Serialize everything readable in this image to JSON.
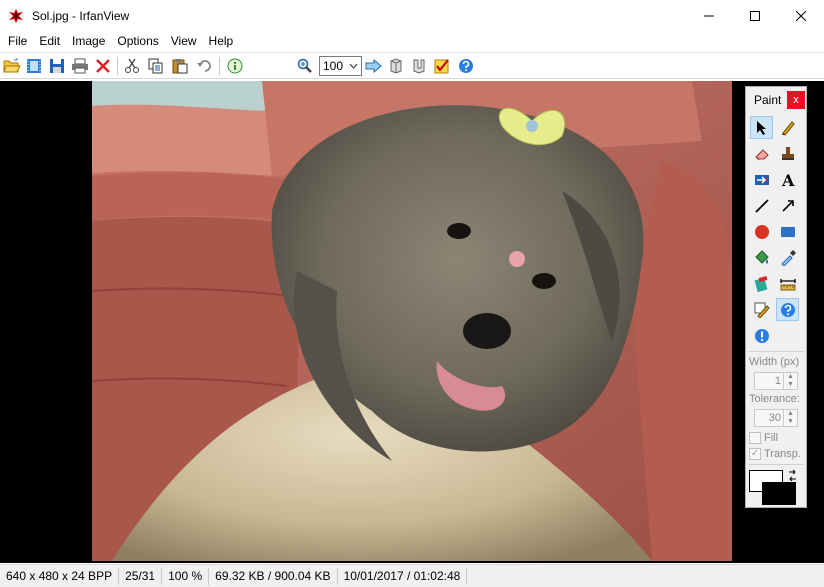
{
  "window": {
    "title": "Sol.jpg - IrfanView"
  },
  "menu": [
    "File",
    "Edit",
    "Image",
    "Options",
    "View",
    "Help"
  ],
  "toolbar": {
    "zoom_value": "100"
  },
  "paint": {
    "title": "Paint",
    "close": "x",
    "width_label": "Width (px)",
    "width_value": "1",
    "tolerance_label": "Tolerance:",
    "tolerance_value": "30",
    "fill_label": "Fill",
    "transp_label": "Transp."
  },
  "status": {
    "dimensions": "640 x 480 x 24 BPP",
    "position": "25/31",
    "zoom": "100 %",
    "filesize": "69.32 KB / 900.04 KB",
    "datetime": "10/01/2017 / 01:02:48"
  },
  "colors": {
    "close_red": "#e81123",
    "selected_tool": "#cce4f7",
    "primary": "#000000",
    "secondary": "#ffffff"
  }
}
